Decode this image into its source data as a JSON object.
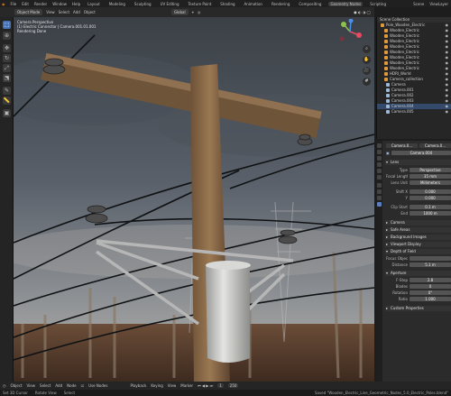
{
  "topbar": {
    "menu": [
      "File",
      "Edit",
      "Render",
      "Window",
      "Help"
    ],
    "workspaces": [
      "Layout",
      "Modeling",
      "Sculpting",
      "UV Editing",
      "Texture Paint",
      "Shading",
      "Animation",
      "Rendering",
      "Compositing",
      "Geometry Nodes",
      "Scripting"
    ],
    "active_workspace": "Geometry Nodes",
    "scene": "Scene",
    "view_layer": "ViewLayer"
  },
  "header": {
    "mode": "Object Mode",
    "menus": [
      "View",
      "Select",
      "Add",
      "Object"
    ],
    "transform": "Global"
  },
  "viewport": {
    "overlay_lines": [
      "Camera Perspective",
      "(1) Electric Connector | Camera.001.01.001",
      "Rendering Done"
    ]
  },
  "outliner": {
    "title": "Scene Collection",
    "rows": [
      {
        "label": "Pole_Wooden_Electric",
        "icon": "mesh"
      },
      {
        "label": "Wooden_Electric",
        "icon": "mesh"
      },
      {
        "label": "Wooden_Electric",
        "icon": "mesh"
      },
      {
        "label": "Wooden_Electric",
        "icon": "mesh"
      },
      {
        "label": "Wooden_Electric",
        "icon": "mesh"
      },
      {
        "label": "Wooden_Electric",
        "icon": "mesh"
      },
      {
        "label": "Wooden_Electric",
        "icon": "mesh"
      },
      {
        "label": "Wooden_Electric",
        "icon": "mesh"
      },
      {
        "label": "Wooden_Electric",
        "icon": "mesh"
      },
      {
        "label": "HDRI_World",
        "icon": "mesh"
      },
      {
        "label": "Camera_collection",
        "icon": "mesh"
      },
      {
        "label": "Camera",
        "icon": "cam"
      },
      {
        "label": "Camera.001",
        "icon": "cam"
      },
      {
        "label": "Camera.002",
        "icon": "cam"
      },
      {
        "label": "Camera.003",
        "icon": "cam"
      },
      {
        "label": "Camera.004",
        "icon": "cam"
      },
      {
        "label": "Camera.005",
        "icon": "cam"
      }
    ]
  },
  "properties": {
    "object_name": "Camera.0...",
    "data_name": "Camera.0...",
    "camera_field": "Camera.004",
    "lens_section": "Lens",
    "rows": [
      {
        "label": "Type",
        "value": "Perspective"
      },
      {
        "label": "Focal Length",
        "value": "35 mm"
      },
      {
        "label": "Lens Unit",
        "value": "Millimeters"
      },
      {
        "label": "Shift X",
        "value": "0.000"
      },
      {
        "label": "Y",
        "value": "0.000"
      },
      {
        "label": "Clip Start",
        "value": "0.1 m"
      },
      {
        "label": "End",
        "value": "1000 m"
      }
    ],
    "sections": [
      "Camera",
      "Safe Areas",
      "Background Images",
      "Viewport Display",
      "Depth of Field"
    ],
    "dof": [
      {
        "label": "Focus Object",
        "value": ""
      },
      {
        "label": "Distance",
        "value": "5.1 m"
      }
    ],
    "aperture_section": "Aperture",
    "aperture": [
      {
        "label": "F-Stop",
        "value": "2.8"
      },
      {
        "label": "Blades",
        "value": "0"
      },
      {
        "label": "Rotation",
        "value": "0°"
      },
      {
        "label": "Ratio",
        "value": "1.000"
      }
    ],
    "custom": "Custom Properties"
  },
  "timeline": {
    "items": [
      "Object",
      "View",
      "Select",
      "Add",
      "Node",
      "Use Nodes"
    ],
    "playback": "Playback",
    "keying": "Keying",
    "view": "View",
    "marker": "Marker",
    "start": "1",
    "end": "250"
  },
  "status": {
    "left": "Set 3D Cursor",
    "mid": "Rotate View",
    "right": "Select",
    "saved": "Saved \"Wooden_Electric_Line_Geometric_Nodes_5.0_Electric_Poles.blend\""
  }
}
